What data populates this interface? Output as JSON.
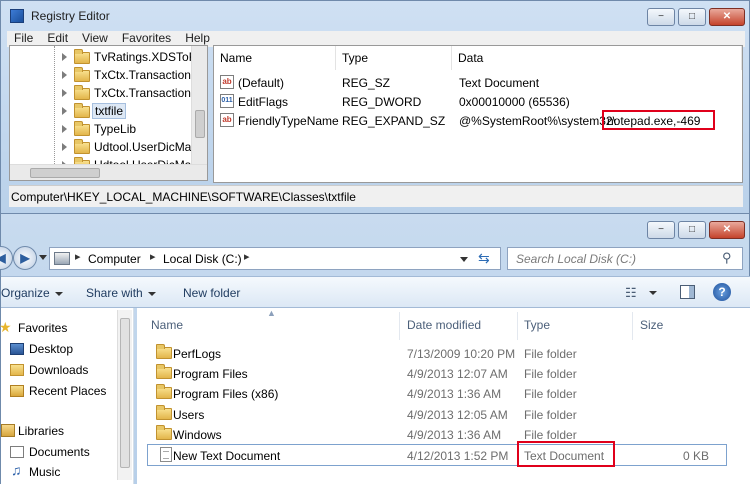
{
  "registry": {
    "title": "Registry Editor",
    "menu": [
      "File",
      "Edit",
      "View",
      "Favorites",
      "Help"
    ],
    "window_controls": {
      "minimize": "−",
      "maximize": "□",
      "close": "✕"
    },
    "tree": [
      {
        "label": "TvRatings.XDSToRa"
      },
      {
        "label": "TxCtx.Transaction"
      },
      {
        "label": "TxCtx.Transaction("
      },
      {
        "label": "txtfile",
        "selected": true
      },
      {
        "label": "TypeLib"
      },
      {
        "label": "Udtool.UserDicMan"
      },
      {
        "label": "Udtool.UserDicMan"
      }
    ],
    "columns": [
      "Name",
      "Type",
      "Data"
    ],
    "values": [
      {
        "name": "(Default)",
        "type": "REG_SZ",
        "data": "Text Document",
        "icon": "ab-string-icon"
      },
      {
        "name": "EditFlags",
        "type": "REG_DWORD",
        "data": "0x00010000 (65536)",
        "icon": "binary-value-icon"
      },
      {
        "name": "FriendlyTypeName",
        "type": "REG_EXPAND_SZ",
        "data_prefix": "@%SystemRoot%\\system32\\",
        "data_highlight": "notepad.exe,-469",
        "icon": "ab-string-icon"
      }
    ],
    "status_path": "Computer\\HKEY_LOCAL_MACHINE\\SOFTWARE\\Classes\\txtfile",
    "highlight_color": "#e0001b"
  },
  "explorer": {
    "window_controls": {
      "minimize": "−",
      "maximize": "□",
      "close": "✕"
    },
    "breadcrumb": [
      "Computer",
      "Local Disk (C:)"
    ],
    "search_placeholder": "Search Local Disk (C:)",
    "toolbar": {
      "organize": "Organize",
      "share_with": "Share with",
      "new_folder": "New folder"
    },
    "nav": {
      "favorites_header": "Favorites",
      "favorites": [
        "Desktop",
        "Downloads",
        "Recent Places"
      ],
      "libraries_header": "Libraries",
      "libraries": [
        "Documents",
        "Music"
      ]
    },
    "columns": {
      "name": "Name",
      "date": "Date modified",
      "type": "Type",
      "size": "Size"
    },
    "files": [
      {
        "name": "PerfLogs",
        "date": "7/13/2009 10:20 PM",
        "type": "File folder",
        "size": "",
        "kind": "folder"
      },
      {
        "name": "Program Files",
        "date": "4/9/2013 12:07 AM",
        "type": "File folder",
        "size": "",
        "kind": "folder"
      },
      {
        "name": "Program Files (x86)",
        "date": "4/9/2013 1:36 AM",
        "type": "File folder",
        "size": "",
        "kind": "folder"
      },
      {
        "name": "Users",
        "date": "4/9/2013 12:05 AM",
        "type": "File folder",
        "size": "",
        "kind": "folder"
      },
      {
        "name": "Windows",
        "date": "4/9/2013 1:36 AM",
        "type": "File folder",
        "size": "",
        "kind": "folder"
      },
      {
        "name": "New Text Document",
        "date": "4/12/2013 1:52 PM",
        "type": "Text Document",
        "size": "0 KB",
        "kind": "text"
      }
    ]
  }
}
